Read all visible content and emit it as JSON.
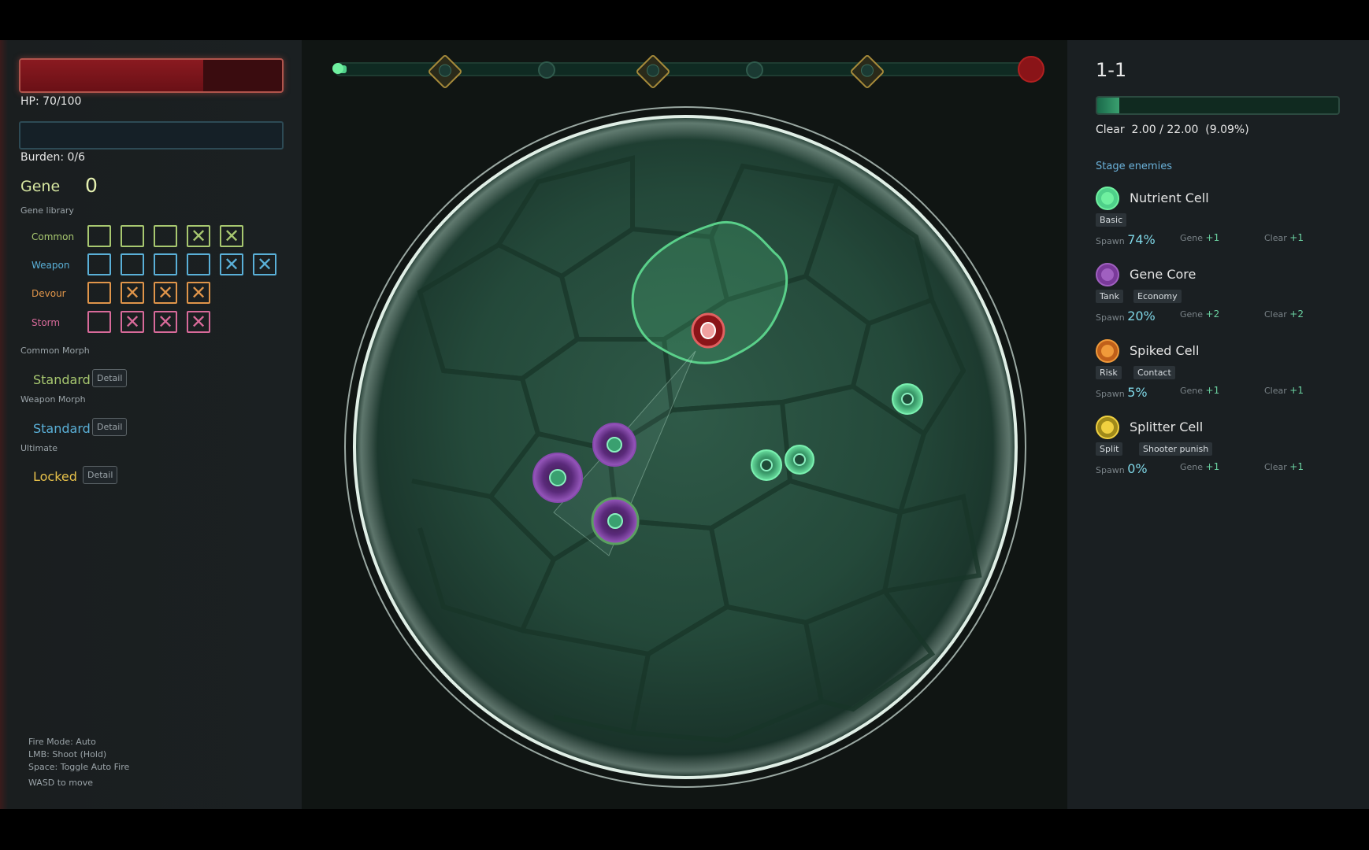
{
  "left": {
    "hp": {
      "label": "HP: 70/100",
      "fraction": 0.7
    },
    "burden": {
      "label": "Burden: 0/6",
      "fraction": 0
    },
    "gene": {
      "label": "Gene",
      "value": "0"
    },
    "gene_library_label": "Gene library",
    "library_rows": [
      {
        "name": "Common",
        "color": "#a8c870",
        "slots": [
          "empty",
          "empty",
          "empty",
          "locked",
          "locked"
        ]
      },
      {
        "name": "Weapon",
        "color": "#5ab0d8",
        "slots": [
          "empty",
          "empty",
          "empty",
          "empty",
          "locked",
          "locked"
        ]
      },
      {
        "name": "Devour",
        "color": "#e0954a",
        "slots": [
          "empty",
          "locked",
          "locked",
          "locked"
        ]
      },
      {
        "name": "Storm",
        "color": "#d86a9a",
        "slots": [
          "empty",
          "locked",
          "locked",
          "locked"
        ]
      }
    ],
    "common_morph": {
      "label": "Common Morph",
      "value": "Standard",
      "color": "#a8c870",
      "detail": "Detail"
    },
    "weapon_morph": {
      "label": "Weapon Morph",
      "value": "Standard",
      "color": "#5ab0d8",
      "detail": "Detail"
    },
    "ultimate": {
      "label": "Ultimate",
      "value": "Locked",
      "color": "#e6c04a",
      "detail": "Detail"
    },
    "controls": [
      "Fire Mode: Auto",
      "LMB: Shoot (Hold)",
      "Space: Toggle Auto Fire",
      "WASD to move"
    ]
  },
  "arena": {
    "progress_fraction": 0.01
  },
  "right": {
    "stage": "1-1",
    "clear": {
      "label": "Clear",
      "value": "2.00 / 22.00  (9.09%)",
      "fraction": 0.0909
    },
    "stage_enemies_label": "Stage enemies",
    "enemies": [
      {
        "name": "Nutrient Cell",
        "color": "#4fd08a",
        "core": "#6ff0a0",
        "tags": [
          "Basic"
        ],
        "spawn": "74%",
        "gene": "+1",
        "clear": "+1"
      },
      {
        "name": "Gene Core",
        "color": "#7a3a9a",
        "core": "#a060c0",
        "tags": [
          "Tank",
          "Economy"
        ],
        "spawn": "20%",
        "gene": "+2",
        "clear": "+2"
      },
      {
        "name": "Spiked Cell",
        "color": "#c0601a",
        "core": "#f09a3a",
        "tags": [
          "Risk",
          "Contact"
        ],
        "spawn": "5%",
        "gene": "+1",
        "clear": "+1"
      },
      {
        "name": "Splitter Cell",
        "color": "#a08a1a",
        "core": "#f0d040",
        "tags": [
          "Split",
          "Shooter punish"
        ],
        "spawn": "0%",
        "gene": "+1",
        "clear": "+1"
      }
    ],
    "stat_labels": {
      "spawn": "Spawn",
      "gene": "Gene",
      "clear": "Clear"
    }
  }
}
